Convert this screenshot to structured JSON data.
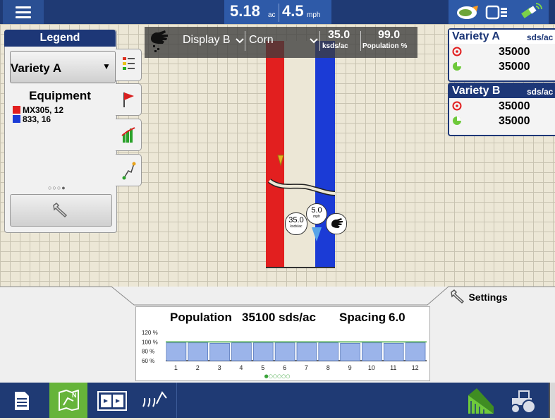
{
  "topbar": {
    "area_value": "5.18",
    "area_unit": "ac",
    "speed_value": "4.5",
    "speed_unit": "mph",
    "icons": [
      "menu-icon",
      "field-status-icon",
      "display-status-icon",
      "gps-satellite-icon"
    ]
  },
  "legend": {
    "title": "Legend",
    "variety_selected": "Variety A",
    "equipment_title": "Equipment",
    "equipment": [
      {
        "label": "MX305, 12",
        "color": "#e21f1f"
      },
      {
        "label": "833, 16",
        "color": "#1b3bd6"
      }
    ],
    "page_dots": "○○○●",
    "tabs": [
      "legend-list-icon",
      "flag-icon",
      "bar-chart-icon",
      "guidance-icon"
    ]
  },
  "display_bar": {
    "hand_icon": "hand-icon",
    "display_label": "Display B",
    "product_label": "Corn",
    "rate_value": "35.0",
    "rate_unit": "ksds/ac",
    "pop_value": "99.0",
    "pop_unit": "Population %"
  },
  "map_overlay": {
    "rate_bubble_value": "35.0",
    "rate_bubble_unit": "ksds/ac",
    "speed_bubble_value": "5.0",
    "speed_bubble_unit": "mph"
  },
  "variety_cards": [
    {
      "name": "Variety A",
      "unit": "sds/ac",
      "target": "35000",
      "actual": "35000"
    },
    {
      "name": "Variety B",
      "unit": "sds/ac",
      "target": "35000",
      "actual": "35000"
    }
  ],
  "settings_label": "Settings",
  "population_panel": {
    "population_label": "Population",
    "population_value": "35100 sds/ac",
    "spacing_label": "Spacing",
    "spacing_value": "6.0",
    "y_ticks": [
      "120 %",
      "100 %",
      "80 %",
      "60 %"
    ],
    "rows": [
      "1",
      "2",
      "3",
      "4",
      "5",
      "6",
      "7",
      "8",
      "9",
      "10",
      "11",
      "12"
    ],
    "row_values_percent": [
      98,
      98,
      97,
      98,
      98,
      98,
      98,
      98,
      97,
      98,
      97,
      98
    ],
    "page_dots": "●○○○○○",
    "bar_color": "#9bb4ea"
  },
  "taskbar": {
    "buttons": [
      "home-icon",
      "map-run-icon",
      "split-screen-icon",
      "seed-icon"
    ],
    "active_button": "map-run-icon",
    "right_icons": [
      "field-coverage-icon",
      "tractor-icon"
    ]
  }
}
